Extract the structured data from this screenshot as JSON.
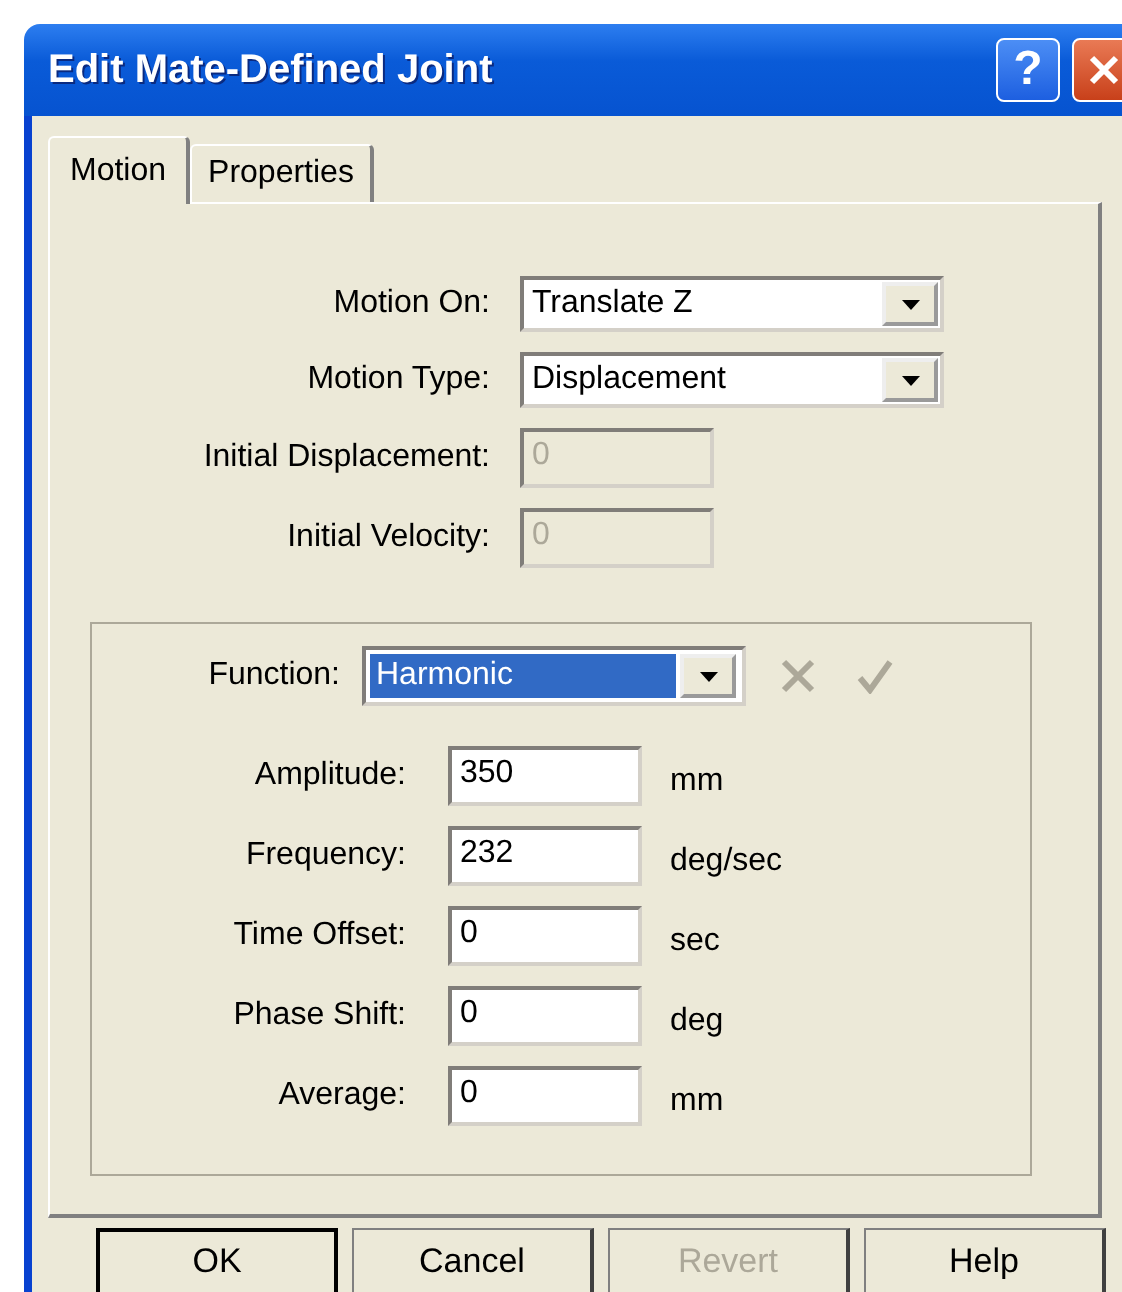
{
  "window": {
    "title": "Edit Mate-Defined Joint",
    "help_label": "?"
  },
  "tabs": [
    {
      "label": "Motion",
      "selected": true
    },
    {
      "label": "Properties",
      "selected": false
    }
  ],
  "motion_fields": [
    {
      "label": "Motion On:",
      "kind": "combo",
      "value": "Translate Z",
      "disabled": false
    },
    {
      "label": "Motion Type:",
      "kind": "combo",
      "value": "Displacement",
      "disabled": false
    },
    {
      "label": "Initial Displacement:",
      "kind": "text",
      "value": "0",
      "disabled": true
    },
    {
      "label": "Initial Velocity:",
      "kind": "text",
      "value": "0",
      "disabled": true
    }
  ],
  "function": {
    "label": "Function:",
    "value": "Harmonic",
    "selected": true,
    "cancel_disabled": true,
    "accept_disabled": true
  },
  "parameters": [
    {
      "label": "Amplitude:",
      "value": "350",
      "unit": "mm"
    },
    {
      "label": "Frequency:",
      "value": "232",
      "unit": "deg/sec"
    },
    {
      "label": "Time Offset:",
      "value": "0",
      "unit": "sec"
    },
    {
      "label": "Phase Shift:",
      "value": "0",
      "unit": "deg"
    },
    {
      "label": "Average:",
      "value": "0",
      "unit": "mm"
    }
  ],
  "buttons": [
    {
      "label": "OK",
      "default": true,
      "disabled": false
    },
    {
      "label": "Cancel",
      "default": false,
      "disabled": false
    },
    {
      "label": "Revert",
      "default": false,
      "disabled": true
    },
    {
      "label": "Help",
      "default": false,
      "disabled": false
    }
  ]
}
